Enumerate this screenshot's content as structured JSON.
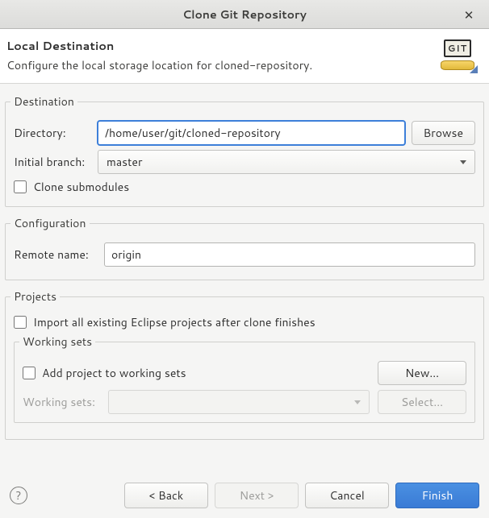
{
  "window": {
    "title": "Clone Git Repository"
  },
  "header": {
    "title": "Local Destination",
    "subtitle": "Configure the local storage location for cloned-repository.",
    "icon_text": "GIT"
  },
  "destination": {
    "legend": "Destination",
    "directory_label": "Directory:",
    "directory_value": "/home/user/git/cloned-repository",
    "browse_label": "Browse",
    "initial_branch_label": "Initial branch:",
    "initial_branch_value": "master",
    "clone_submodules_label": "Clone submodules",
    "clone_submodules_checked": false
  },
  "configuration": {
    "legend": "Configuration",
    "remote_name_label": "Remote name:",
    "remote_name_value": "origin"
  },
  "projects": {
    "legend": "Projects",
    "import_label": "Import all existing Eclipse projects after clone finishes",
    "import_checked": false,
    "working_sets_legend": "Working sets",
    "add_to_ws_label": "Add project to working sets",
    "add_to_ws_checked": false,
    "new_label": "New...",
    "working_sets_label": "Working sets:",
    "working_sets_value": "",
    "select_label": "Select..."
  },
  "footer": {
    "help": "?",
    "back": "< Back",
    "next": "Next >",
    "cancel": "Cancel",
    "finish": "Finish"
  }
}
